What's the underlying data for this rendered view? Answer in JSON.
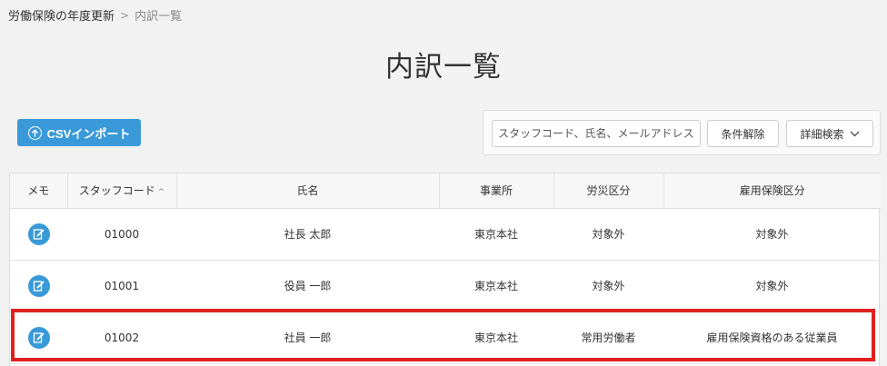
{
  "breadcrumb": {
    "parent": "労働保険の年度更新",
    "separator": ">",
    "current": "内訳一覧"
  },
  "page_title": "内訳一覧",
  "toolbar": {
    "csv_import_label": "CSVインポート"
  },
  "search": {
    "placeholder": "スタッフコード、氏名、メールアドレス",
    "value": "",
    "clear_label": "条件解除",
    "detail_label": "詳細検索"
  },
  "table": {
    "columns": [
      "メモ",
      "スタッフコード",
      "氏名",
      "事業所",
      "労災区分",
      "雇用保険区分"
    ],
    "sort_indicator": "^",
    "rows": [
      {
        "code": "01000",
        "name": "社長 太郎",
        "office": "東京本社",
        "rosai": "対象外",
        "koyo": "対象外"
      },
      {
        "code": "01001",
        "name": "役員 一郎",
        "office": "東京本社",
        "rosai": "対象外",
        "koyo": "対象外"
      },
      {
        "code": "01002",
        "name": "社員 一郎",
        "office": "東京本社",
        "rosai": "常用労働者",
        "koyo": "雇用保険資格のある従業員"
      }
    ]
  },
  "colors": {
    "accent": "#3a9ad9",
    "highlight": "#e0211f",
    "background": "#f2f2f2"
  },
  "icons": {
    "csv": "upload-circle-icon",
    "memo": "memo-edit-icon",
    "detail": "chevron-down-icon"
  }
}
